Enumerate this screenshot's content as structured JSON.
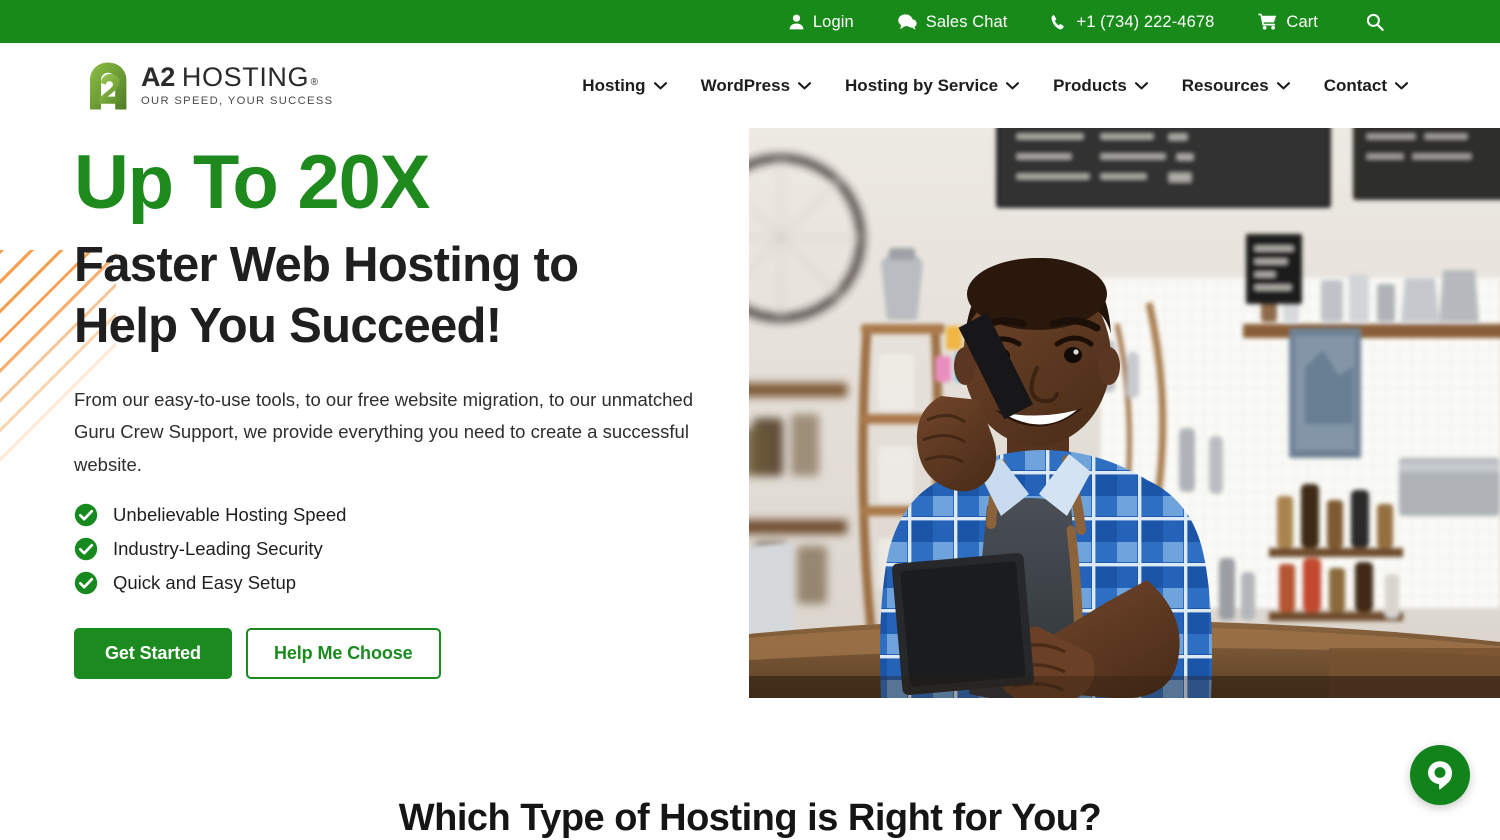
{
  "topbar": {
    "items": [
      {
        "label": "Login",
        "icon": "user-icon"
      },
      {
        "label": "Sales Chat",
        "icon": "chat-bubble-icon"
      },
      {
        "label": "+1 (734) 222-4678",
        "icon": "phone-icon"
      },
      {
        "label": "Cart",
        "icon": "cart-icon"
      }
    ],
    "search_icon": "search-icon",
    "background_color": "#178A19"
  },
  "header": {
    "logo": {
      "mark": "a2-logo-mark",
      "name_bold": "A2",
      "name_rest": "HOSTING",
      "registered": "®",
      "tagline": "OUR SPEED, YOUR SUCCESS"
    },
    "nav": [
      {
        "label": "Hosting",
        "caret": "chevron-down-icon"
      },
      {
        "label": "WordPress",
        "caret": "chevron-down-icon"
      },
      {
        "label": "Hosting by Service",
        "caret": "chevron-down-icon"
      },
      {
        "label": "Products",
        "caret": "chevron-down-icon"
      },
      {
        "label": "Resources",
        "caret": "chevron-down-icon"
      },
      {
        "label": "Contact",
        "caret": "chevron-down-icon"
      }
    ]
  },
  "hero": {
    "eyebrow": "Up To 20X",
    "title_line1": "Faster Web Hosting to",
    "title_line2": "Help You Succeed!",
    "description": "From our easy-to-use tools, to our free website migration, to our unmatched Guru Crew Support, we provide everything you need to create a successful website.",
    "features": [
      {
        "label": "Unbelievable Hosting Speed",
        "icon": "check-circle-icon"
      },
      {
        "label": "Industry-Leading Security",
        "icon": "check-circle-icon"
      },
      {
        "label": "Quick and Easy Setup",
        "icon": "check-circle-icon"
      }
    ],
    "primary_cta": "Get Started",
    "secondary_cta": "Help Me Choose",
    "accent_green": "#1E8A1E",
    "stripe_orange": "#F5A152",
    "photo_alt": "Smiling cafe owner holding a tablet and talking on a mobile phone behind the counter"
  },
  "bottom_section": {
    "heading": "Which Type of Hosting is Right for You?"
  },
  "chat_widget": {
    "icon": "chat-pin-icon",
    "color": "#11831A"
  }
}
